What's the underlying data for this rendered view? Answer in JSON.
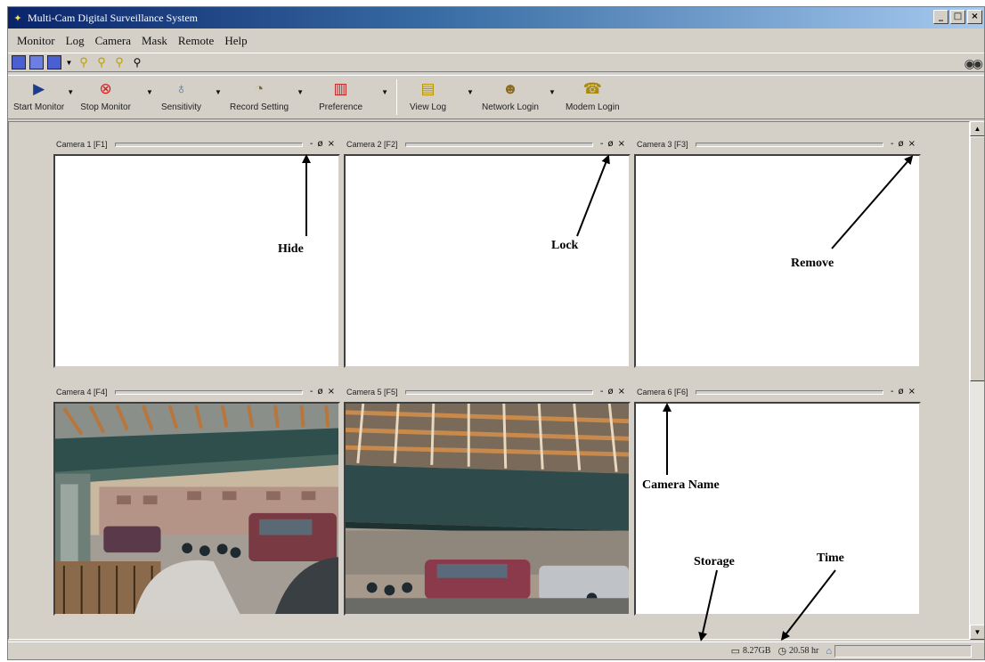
{
  "window": {
    "title": "Multi-Cam Digital Surveillance System",
    "controls": [
      "_",
      "□",
      "×"
    ]
  },
  "menu": [
    "Monitor",
    "Log",
    "Camera",
    "Mask",
    "Remote",
    "Help"
  ],
  "toolbar": [
    {
      "label": "Start Monitor",
      "icon": "start-monitor-icon"
    },
    {
      "label": "Stop Monitor",
      "icon": "stop-monitor-icon"
    },
    {
      "label": "Sensitivity",
      "icon": "sensitivity-icon"
    },
    {
      "label": "Record Setting",
      "icon": "record-setting-icon"
    },
    {
      "label": "Preference",
      "icon": "preference-icon"
    },
    {
      "label": "View Log",
      "icon": "view-log-icon"
    },
    {
      "label": "Network Login",
      "icon": "network-login-icon"
    },
    {
      "label": "Modem Login",
      "icon": "modem-login-icon"
    }
  ],
  "cameras": [
    {
      "name": "Camera 1 [F1]",
      "feed": "blank"
    },
    {
      "name": "Camera 2 [F2]",
      "feed": "blank"
    },
    {
      "name": "Camera 3 [F3]",
      "feed": "blank"
    },
    {
      "name": "Camera 4 [F4]",
      "feed": "video"
    },
    {
      "name": "Camera 5 [F5]",
      "feed": "video"
    },
    {
      "name": "Camera 6 [F6]",
      "feed": "blank"
    }
  ],
  "camera_controls": {
    "hide": "-",
    "lock": "ø",
    "remove": "×"
  },
  "annotations": {
    "hide": "Hide",
    "lock": "Lock",
    "remove": "Remove",
    "camera_name": "Camera Name",
    "storage": "Storage",
    "time": "Time"
  },
  "status": {
    "storage": "8.27GB",
    "time": "20.58 hr"
  },
  "colors": {
    "title_start": "#0a246a",
    "title_end": "#a6caf0",
    "face": "#d4d0c8",
    "stop_red": "#d41c1c"
  }
}
